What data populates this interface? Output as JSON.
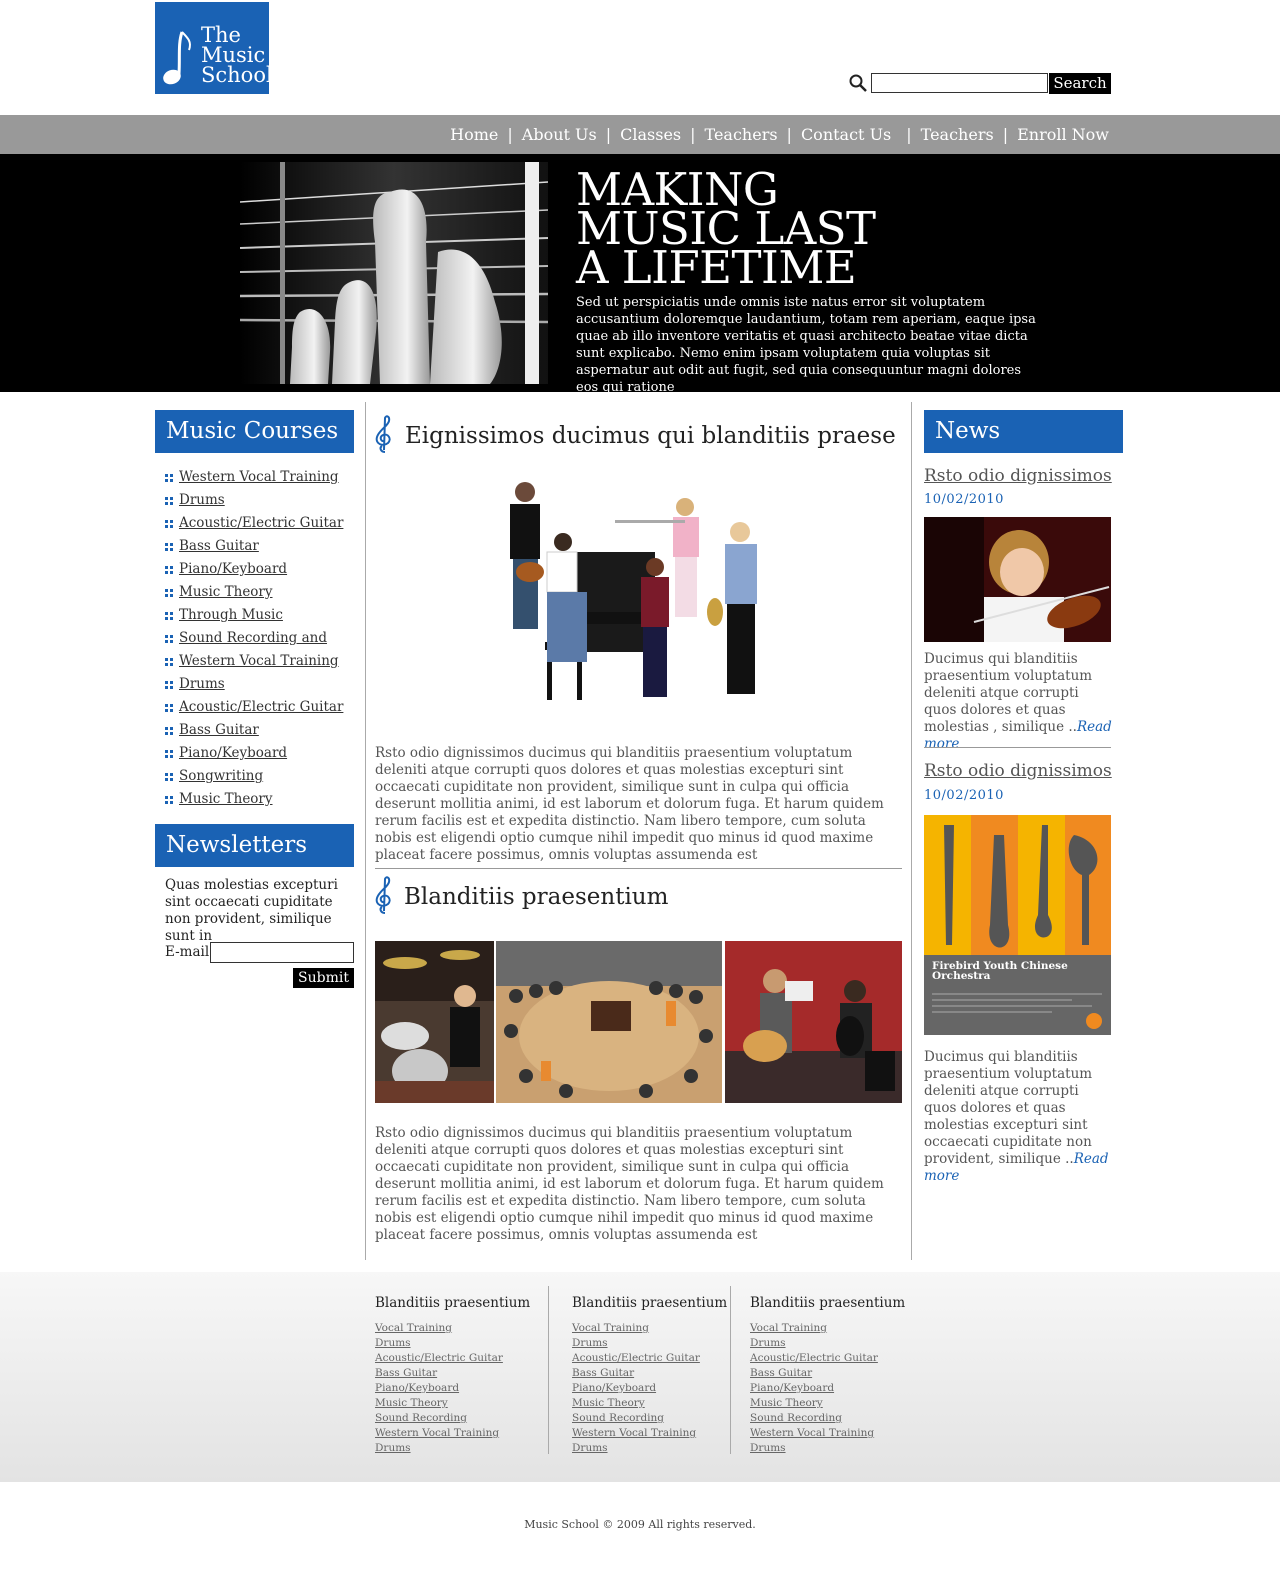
{
  "header": {
    "logo_lines": [
      "The",
      "Music",
      "School"
    ],
    "search_placeholder": "",
    "search_button": "Search"
  },
  "nav": [
    "Home",
    "About Us",
    "Classes",
    "Teachers",
    "Contact Us",
    "Teachers",
    "Enroll Now"
  ],
  "hero": {
    "title_lines": [
      "MAKING",
      "MUSIC LAST",
      "A LIFETIME"
    ],
    "text": "Sed ut perspiciatis unde omnis iste natus error sit voluptatem accusantium doloremque laudantium, totam rem aperiam, eaque ipsa quae ab illo inventore veritatis et quasi architecto beatae vitae dicta sunt explicabo. Nemo enim ipsam voluptatem quia voluptas sit aspernatur aut odit aut fugit, sed quia consequuntur magni dolores eos qui ratione"
  },
  "courses": {
    "title": "Music Courses",
    "items": [
      "Western Vocal Training",
      "Drums",
      "Acoustic/Electric Guitar",
      "Bass Guitar",
      "Piano/Keyboard",
      "Music Theory",
      "Through Music",
      "Sound Recording and",
      "Western Vocal Training",
      "Drums",
      "Acoustic/Electric Guitar",
      "Bass Guitar",
      "Piano/Keyboard",
      "Songwriting",
      "Music Theory"
    ]
  },
  "newsletters": {
    "title": "Newsletters",
    "text": "Quas molestias excepturi sint occaecati cupiditate non provident, similique sunt in",
    "email_label": "E-mail",
    "submit": "Submit"
  },
  "main": {
    "article1": {
      "title": "Eignissimos ducimus qui blanditiis praese",
      "text": "Rsto odio dignissimos ducimus qui blanditiis praesentium voluptatum deleniti atque corrupti quos dolores et quas molestias excepturi sint occaecati cupiditate non provident, similique sunt in culpa qui officia deserunt mollitia animi, id est laborum et dolorum fuga. Et harum quidem rerum facilis est et expedita distinctio. Nam libero tempore, cum soluta nobis est eligendi optio cumque nihil impedit quo minus id quod maxime placeat facere possimus, omnis voluptas assumenda est"
    },
    "article2": {
      "title": "Blanditiis praesentium",
      "text": "Rsto odio dignissimos ducimus qui blanditiis praesentium voluptatum deleniti atque corrupti quos dolores et quas molestias excepturi sint occaecati cupiditate non provident, similique sunt in culpa qui officia deserunt mollitia animi, id est laborum et dolorum fuga. Et harum quidem rerum facilis est et expedita distinctio. Nam libero tempore, cum soluta nobis est eligendi optio cumque nihil impedit quo minus id quod maxime placeat facere possimus, omnis voluptas assumenda est"
    }
  },
  "news": {
    "title": "News",
    "items": [
      {
        "headline": "Rsto odio dignissimos",
        "date": "10/02/2010",
        "text": "Ducimus qui blanditiis praesentium voluptatum deleniti atque corrupti quos dolores et quas molestias , similique ..",
        "read_more": "Read more"
      },
      {
        "headline": "Rsto odio dignissimos",
        "date": "10/02/2010",
        "text": "Ducimus qui blanditiis praesentium voluptatum deleniti atque corrupti quos dolores et quas molestias excepturi sint occaecati cupiditate non provident, similique ..",
        "read_more": "Read more"
      }
    ],
    "poster_text": [
      "Firebird Youth Chinese",
      "Orchestra"
    ]
  },
  "footer": {
    "columns": [
      {
        "title": "Blanditiis praesentium",
        "links": [
          "Vocal Training",
          "Drums",
          "Acoustic/Electric Guitar",
          "Bass Guitar",
          "Piano/Keyboard",
          "Music Theory",
          "Sound Recording",
          "Western Vocal Training",
          "Drums"
        ]
      },
      {
        "title": "Blanditiis praesentium",
        "links": [
          "Vocal Training",
          "Drums",
          "Acoustic/Electric Guitar",
          "Bass Guitar",
          "Piano/Keyboard",
          "Music Theory",
          "Sound Recording",
          "Western Vocal Training",
          "Drums"
        ]
      },
      {
        "title": "Blanditiis praesentium",
        "links": [
          "Vocal Training",
          "Drums",
          "Acoustic/Electric Guitar",
          "Bass Guitar",
          "Piano/Keyboard",
          "Music Theory",
          "Sound Recording",
          "Western Vocal Training",
          "Drums"
        ]
      }
    ],
    "copyright": "Music School © 2009 All rights reserved."
  },
  "colors": {
    "brand_blue": "#1a62b4",
    "nav_gray": "#999999",
    "hero_bg": "#000000"
  }
}
